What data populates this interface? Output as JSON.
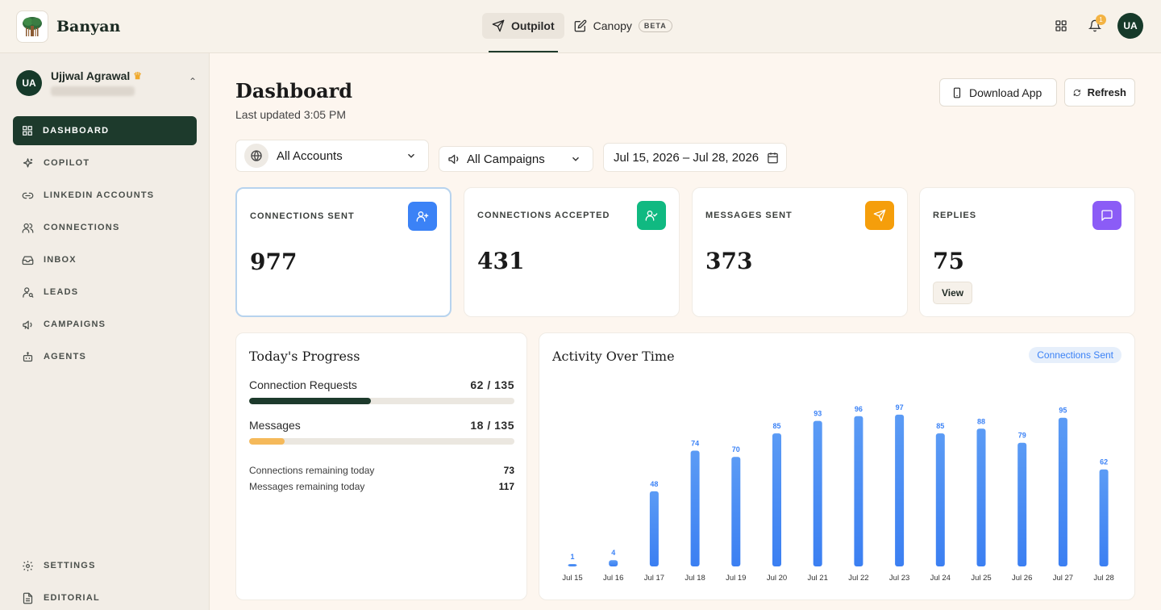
{
  "app": {
    "brand": "Banyan"
  },
  "nav": {
    "tabs": [
      {
        "label": "Outpilot",
        "icon": "send-icon",
        "active": true
      },
      {
        "label": "Canopy",
        "icon": "edit-icon",
        "badge": "BETA"
      }
    ],
    "notifications": "1",
    "avatar": "UA"
  },
  "sidebar": {
    "user": {
      "initials": "UA",
      "name": "Ujjwal Agrawal"
    },
    "items": [
      {
        "label": "DASHBOARD",
        "icon": "grid-icon",
        "active": true
      },
      {
        "label": "COPILOT",
        "icon": "sparkles-icon"
      },
      {
        "label": "LINKEDIN ACCOUNTS",
        "icon": "link-icon"
      },
      {
        "label": "CONNECTIONS",
        "icon": "users-icon"
      },
      {
        "label": "INBOX",
        "icon": "inbox-icon"
      },
      {
        "label": "LEADS",
        "icon": "user-search-icon"
      },
      {
        "label": "CAMPAIGNS",
        "icon": "megaphone-icon"
      },
      {
        "label": "AGENTS",
        "icon": "bot-icon"
      }
    ],
    "bottom": [
      {
        "label": "SETTINGS",
        "icon": "gear-icon"
      },
      {
        "label": "EDITORIAL",
        "icon": "document-icon"
      }
    ]
  },
  "header": {
    "title": "Dashboard",
    "updated": "Last updated 3:05 PM",
    "download_label": "Download App",
    "refresh_label": "Refresh"
  },
  "filters": {
    "accounts": "All Accounts",
    "campaigns": "All Campaigns",
    "dates": "Jul 15, 2026 – Jul 28, 2026"
  },
  "stats": [
    {
      "label": "CONNECTIONS SENT",
      "value": "977",
      "color": "#3b82f6",
      "icon": "user-plus-icon"
    },
    {
      "label": "CONNECTIONS ACCEPTED",
      "value": "431",
      "color": "#10b981",
      "icon": "user-check-icon"
    },
    {
      "label": "MESSAGES SENT",
      "value": "373",
      "color": "#f59e0b",
      "icon": "send-icon"
    },
    {
      "label": "REPLIES",
      "value": "75",
      "color": "#8b5cf6",
      "icon": "message-icon",
      "action": "View"
    }
  ],
  "progress": {
    "title": "Today's Progress",
    "rows": [
      {
        "label": "Connection Requests",
        "value": "62 / 135",
        "fraction": 0.459,
        "color": "#1d3a2c"
      },
      {
        "label": "Messages",
        "value": "18 / 135",
        "fraction": 0.133,
        "color": "#f5b95a"
      }
    ],
    "remaining": [
      {
        "label": "Connections remaining today",
        "value": "73"
      },
      {
        "label": "Messages remaining today",
        "value": "117"
      }
    ]
  },
  "activity": {
    "title": "Activity Over Time",
    "legend": "Connections Sent"
  },
  "chart_data": {
    "type": "bar",
    "categories": [
      "Jul 15",
      "Jul 16",
      "Jul 17",
      "Jul 18",
      "Jul 19",
      "Jul 20",
      "Jul 21",
      "Jul 22",
      "Jul 23",
      "Jul 24",
      "Jul 25",
      "Jul 26",
      "Jul 27",
      "Jul 28"
    ],
    "series": [
      {
        "name": "Connections Sent",
        "values": [
          1,
          4,
          48,
          74,
          70,
          85,
          93,
          96,
          97,
          85,
          88,
          79,
          95,
          62
        ],
        "color": "#3b82f6"
      }
    ],
    "ylim": [
      0,
      100
    ],
    "grid": false,
    "legend": "top-right"
  }
}
